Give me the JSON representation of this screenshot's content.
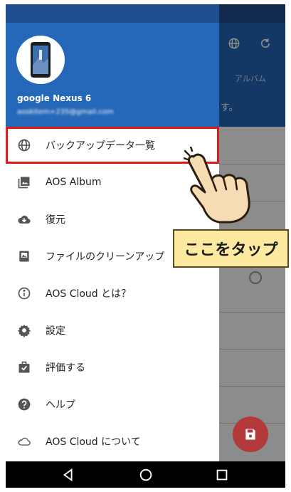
{
  "background_app": {
    "subtitle": "アルバム",
    "message_fragment": "す。",
    "toolbar_icons": [
      "globe-icon",
      "refresh-icon"
    ]
  },
  "drawer": {
    "device_name": "google Nexus 6",
    "account_email": "aoskitem+235@gmail.com",
    "items": [
      {
        "icon": "globe-icon",
        "label": "バックアップデータ一覧",
        "highlighted": true
      },
      {
        "icon": "album-icon",
        "label": "AOS Album"
      },
      {
        "icon": "cloud-download-icon",
        "label": "復元"
      },
      {
        "icon": "file-cleanup-icon",
        "label": "ファイルのクリーンアップ"
      },
      {
        "icon": "info-icon",
        "label": "AOS Cloud とは？"
      },
      {
        "icon": "gear-icon",
        "label": "設定"
      },
      {
        "icon": "rate-icon",
        "label": "評価する"
      },
      {
        "icon": "help-icon",
        "label": "ヘルプ"
      },
      {
        "icon": "cloud-outline-icon",
        "label": "AOS Cloud について"
      }
    ]
  },
  "annotation": {
    "callout_text": "ここをタップ"
  },
  "navbar": {
    "buttons": [
      "back-icon",
      "home-icon",
      "recents-icon"
    ]
  },
  "colors": {
    "header_blue": "#2567b8",
    "status_blue": "#1f4e8e",
    "highlight_red": "#e31a1a",
    "callout_fill": "#fde99f",
    "fab_red": "#b23a3a",
    "icon_gray": "#555555"
  }
}
